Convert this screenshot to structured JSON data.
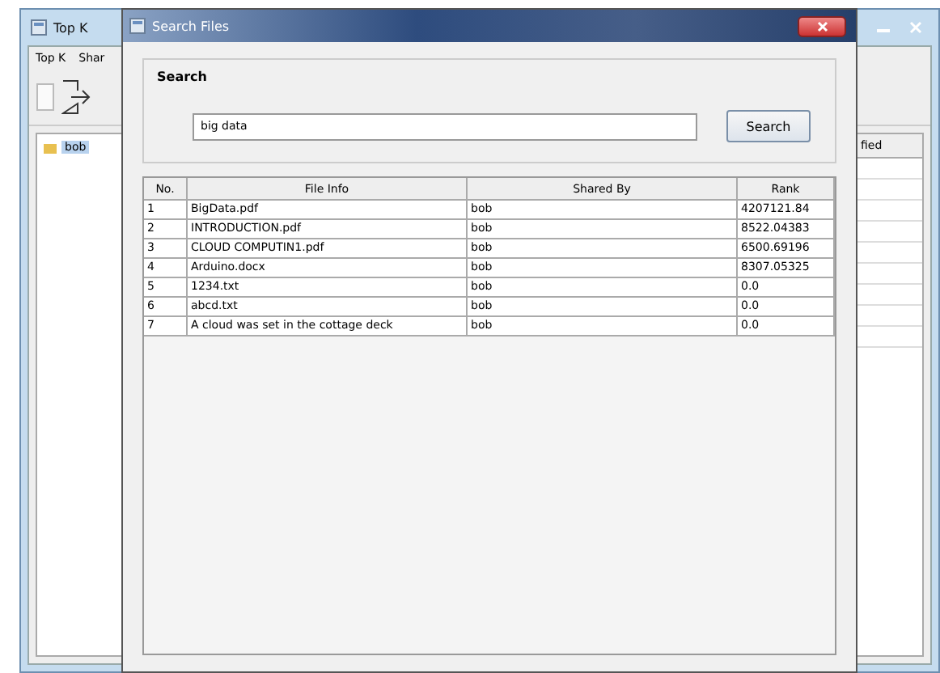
{
  "main_window": {
    "title": "Top K",
    "menu": [
      "Top K",
      "Shar"
    ],
    "tree": [
      {
        "label": "bob",
        "selected": true
      }
    ],
    "table": {
      "column_header": "fied"
    }
  },
  "dialog": {
    "title": "Search Files",
    "group_title": "Search",
    "search": {
      "value": "big data"
    },
    "search_button": "Search",
    "table": {
      "columns": [
        "No.",
        "File Info",
        "Shared By",
        "Rank"
      ],
      "rows": [
        [
          "1",
          "BigData.pdf",
          "bob",
          "4207121.84"
        ],
        [
          "2",
          "INTRODUCTION.pdf",
          "bob",
          "8522.04383"
        ],
        [
          "3",
          "CLOUD COMPUTIN1.pdf",
          "bob",
          "6500.69196"
        ],
        [
          "4",
          "Arduino.docx",
          "bob",
          "8307.05325"
        ],
        [
          "5",
          "1234.txt",
          "bob",
          "0.0"
        ],
        [
          "6",
          "abcd.txt",
          "bob",
          "0.0"
        ],
        [
          "7",
          "A cloud was set in the cottage deck",
          "bob",
          "0.0"
        ]
      ]
    }
  }
}
